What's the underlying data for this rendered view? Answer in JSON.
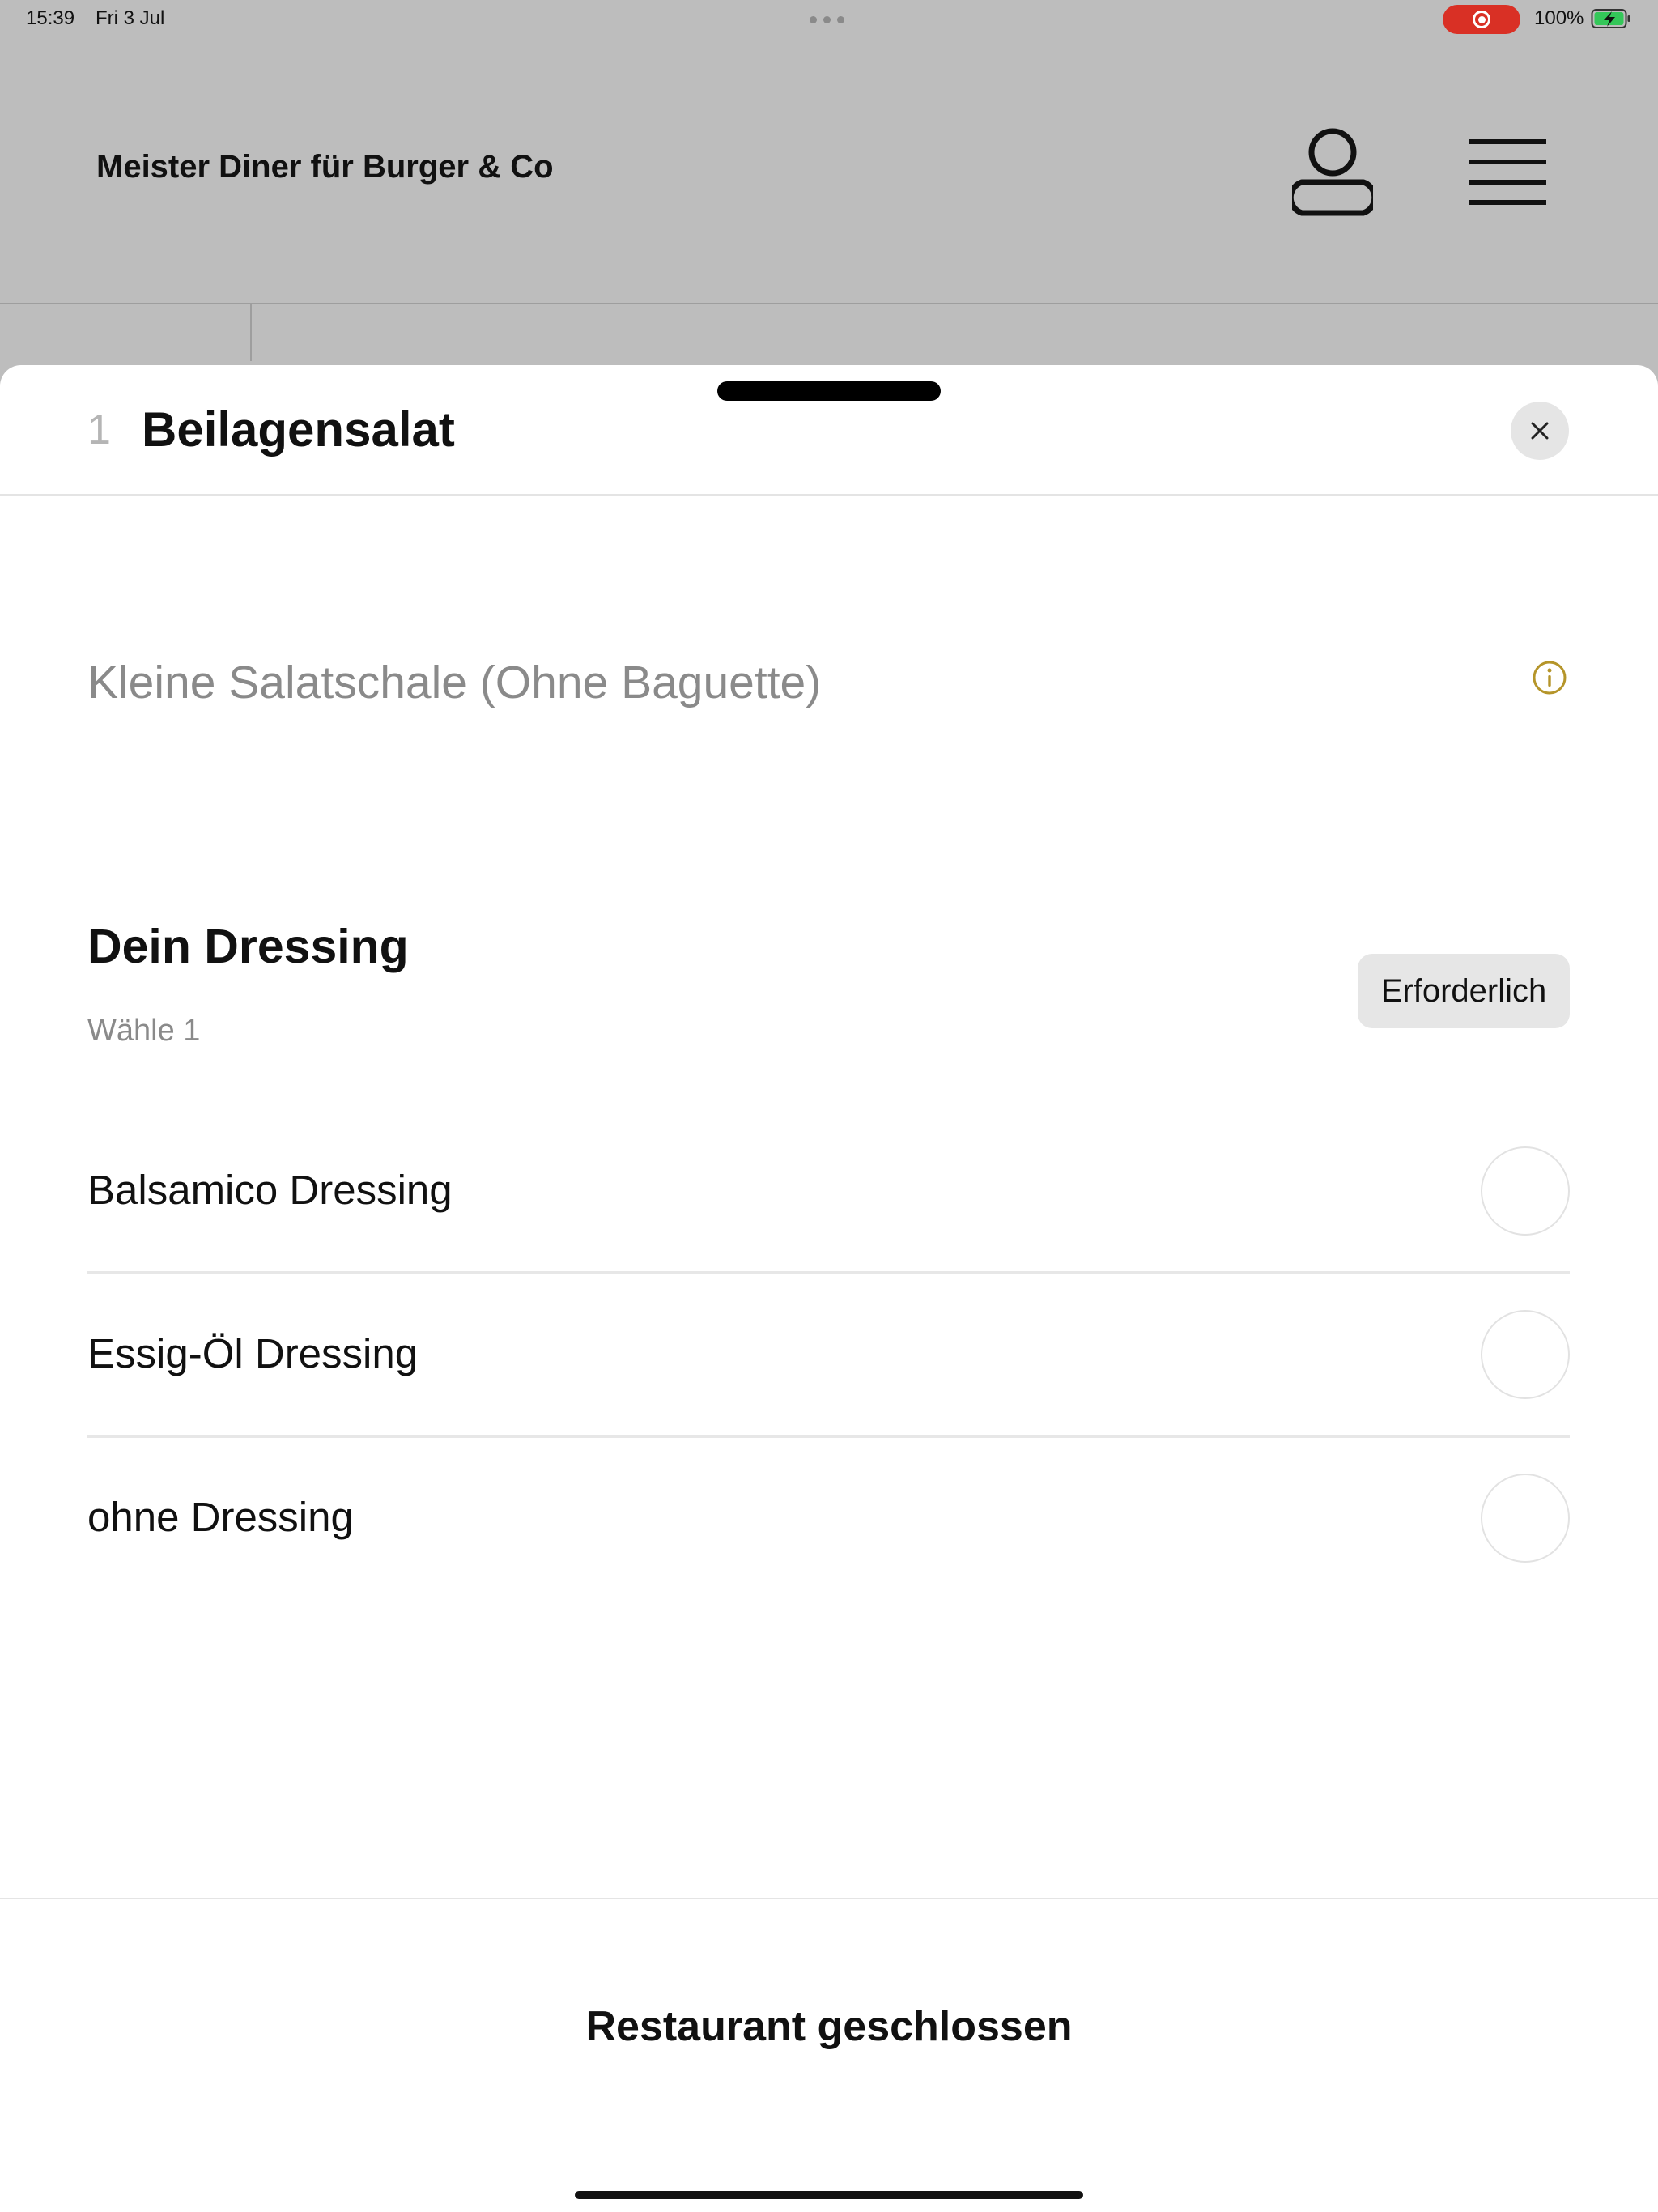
{
  "status_bar": {
    "time": "15:39",
    "date": "Fri 3 Jul",
    "battery": "100%"
  },
  "header": {
    "restaurant_name": "Meister Diner für Burger & Co",
    "icons": [
      "profile-icon",
      "menu-icon"
    ]
  },
  "sheet": {
    "quantity": "1",
    "title": "Beilagensalat",
    "description": "Kleine Salatschale (Ohne Baguette)",
    "group": {
      "title": "Dein Dressing",
      "subtitle": "Wähle 1",
      "badge": "Erforderlich"
    },
    "options": [
      {
        "label": "Balsamico Dressing",
        "selected": false
      },
      {
        "label": "Essig-Öl Dressing",
        "selected": false
      },
      {
        "label": "ohne Dressing",
        "selected": false
      }
    ],
    "footer_status": "Restaurant geschlossen"
  },
  "colors": {
    "recording": "#d93025",
    "info_accent": "#b5952a",
    "battery_charge": "#34c759"
  }
}
